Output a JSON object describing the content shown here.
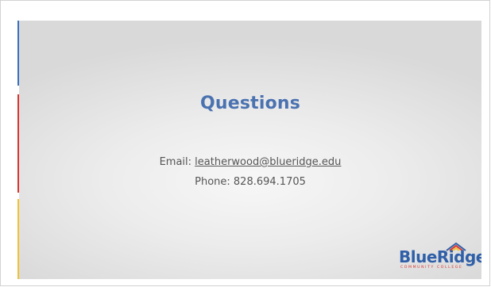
{
  "slide": {
    "title": "Questions",
    "email_label": "Email:",
    "email_address": "leatherwood@blueridge.edu",
    "phone_label": "Phone:",
    "phone_number": "828.694.1705"
  },
  "logo": {
    "name": "BlueRidge",
    "subtitle": "COMMUNITY COLLEGE"
  },
  "colors": {
    "accent_blue": "#3a6fc0",
    "accent_red": "#d9342b",
    "accent_yellow": "#f2c12e",
    "title_blue": "#4a72b0"
  }
}
